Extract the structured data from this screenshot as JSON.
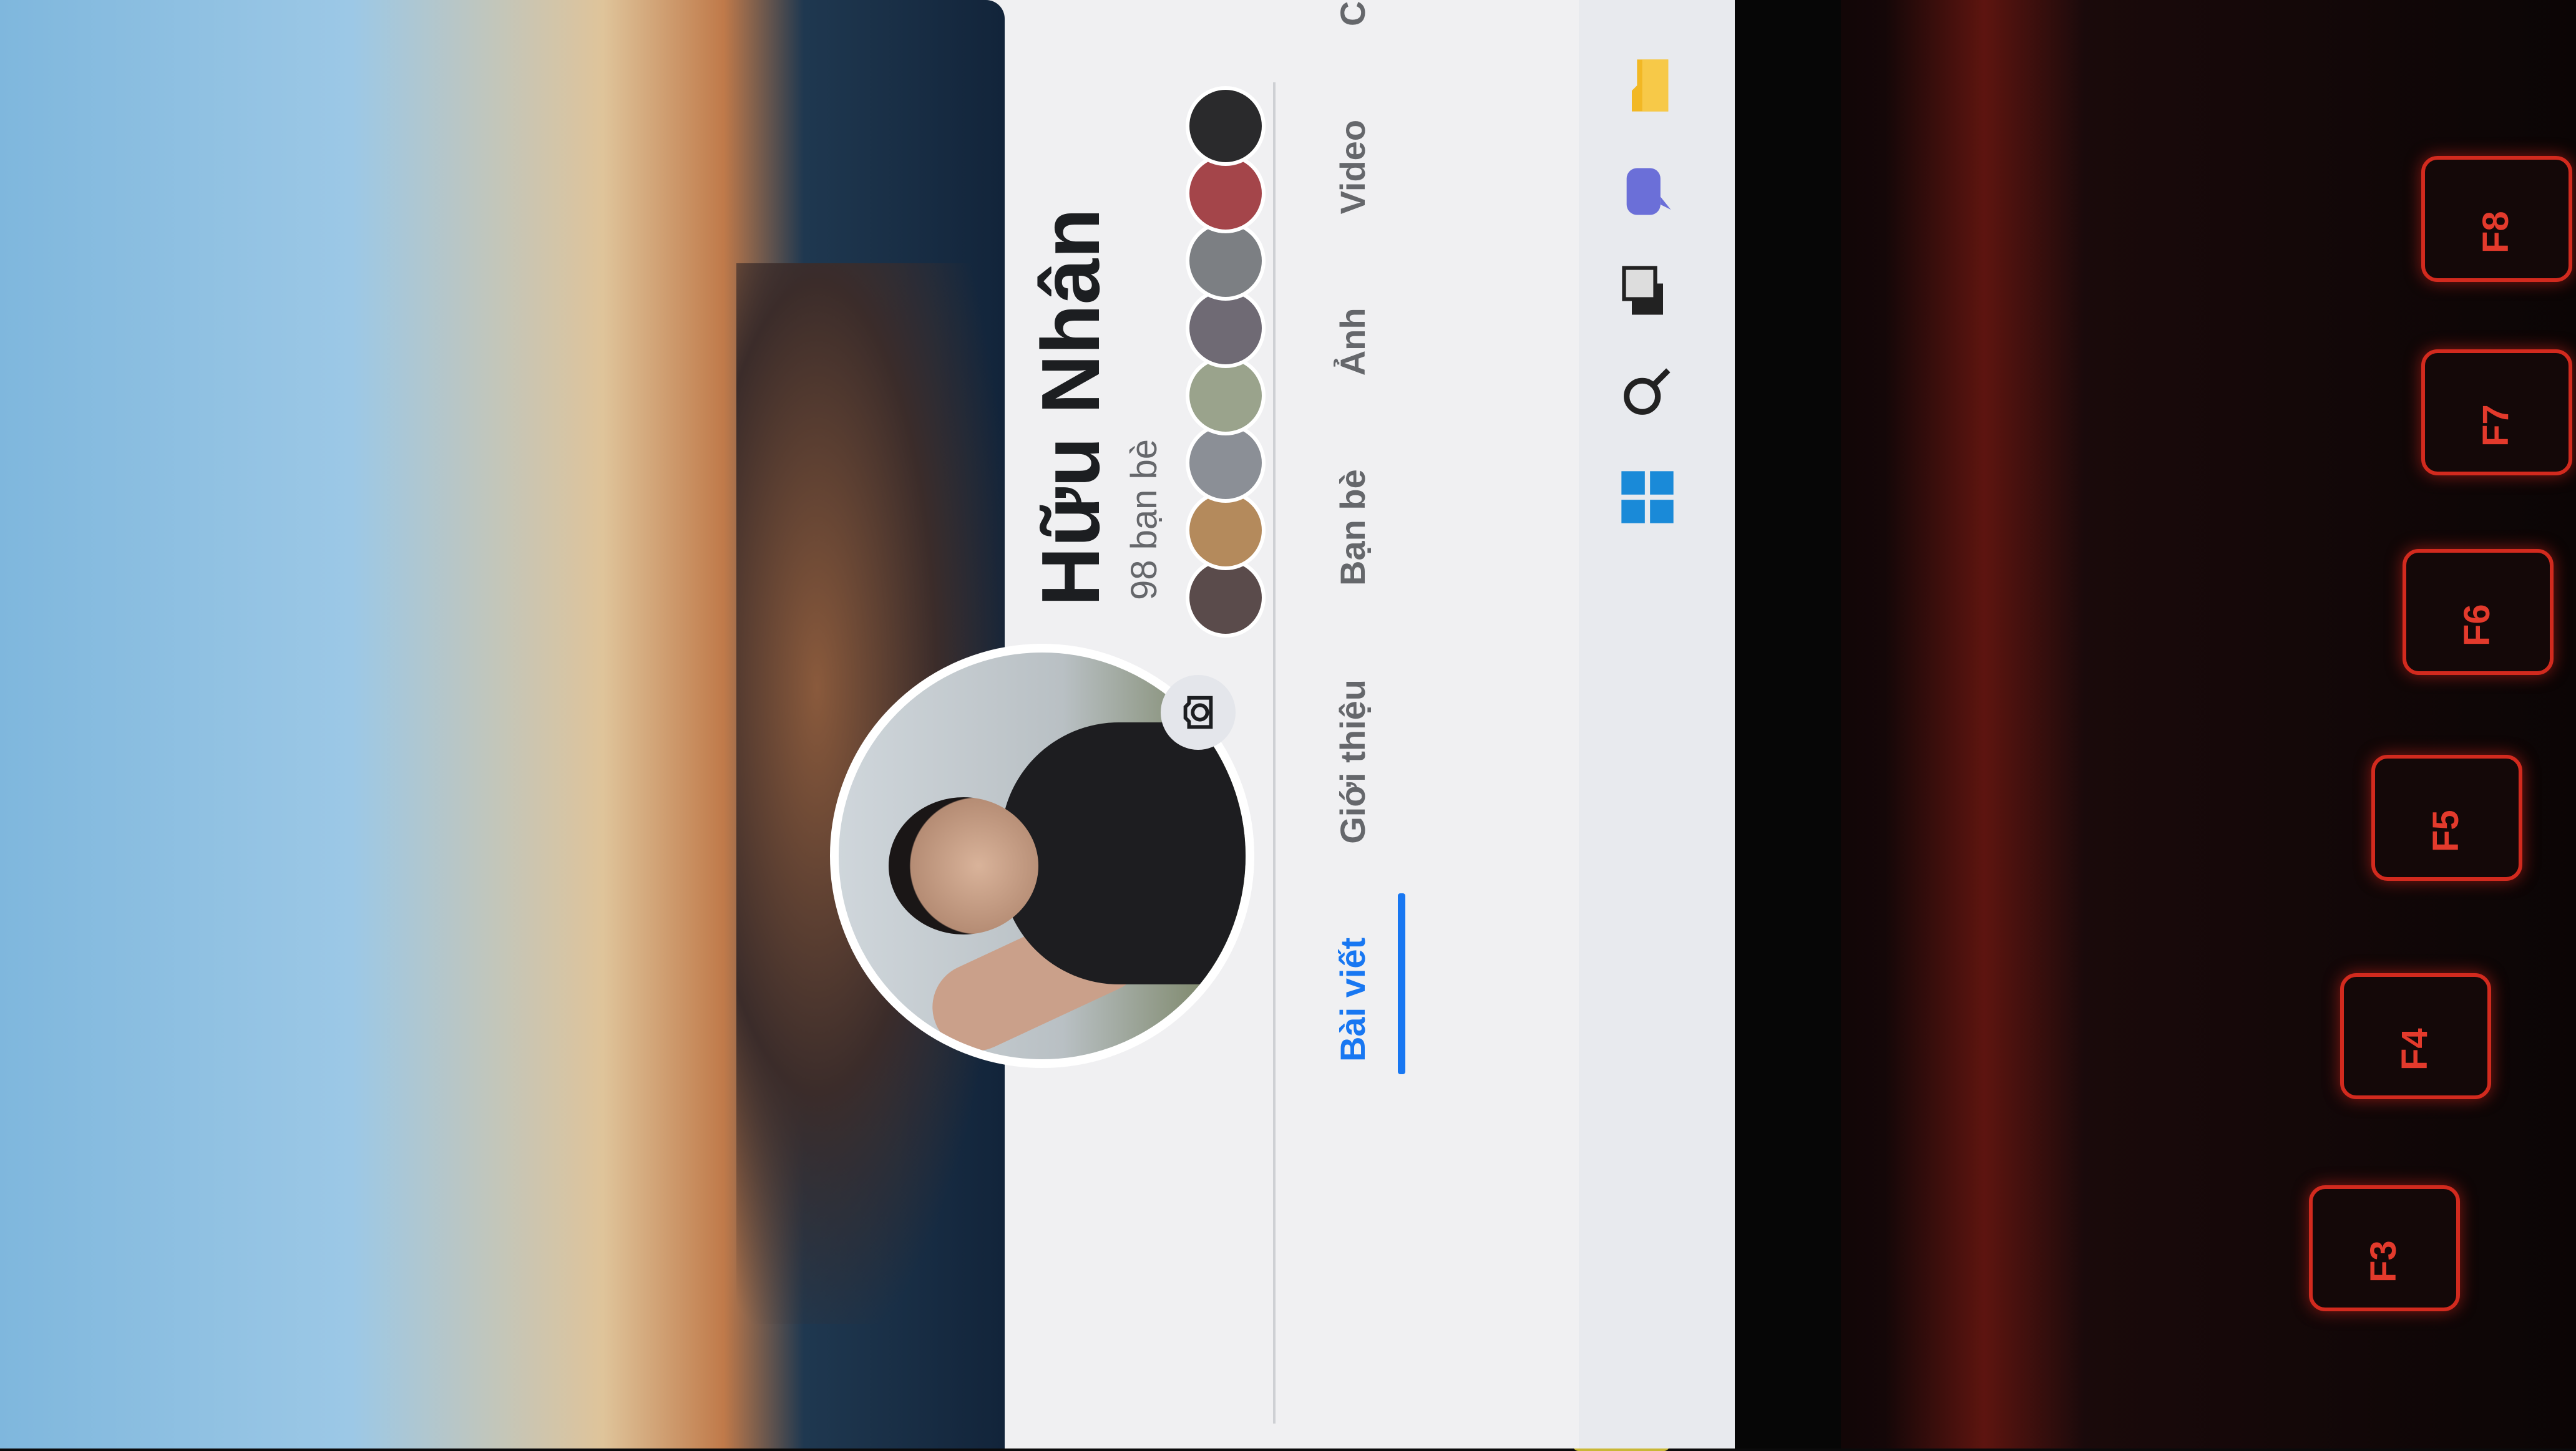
{
  "profile": {
    "name": "Hữu Nhân",
    "friends_count": "98 bạn bè"
  },
  "tabs": [
    {
      "label": "Bài viết",
      "active": true
    },
    {
      "label": "Giới thiệu",
      "active": false
    },
    {
      "label": "Bạn bè",
      "active": false
    },
    {
      "label": "Ảnh",
      "active": false
    },
    {
      "label": "Video",
      "active": false
    },
    {
      "label": "Check in",
      "active": false
    }
  ],
  "keyboard": {
    "keys": [
      "F3",
      "F4",
      "F5",
      "F6",
      "F7",
      "F8"
    ]
  },
  "colors": {
    "accent": "#1877f2",
    "keyboard_backlight": "#d22a1e"
  },
  "icons": [
    "camera-icon",
    "windows-start-icon",
    "search-icon",
    "task-view-icon",
    "chat-icon",
    "file-explorer-icon"
  ]
}
